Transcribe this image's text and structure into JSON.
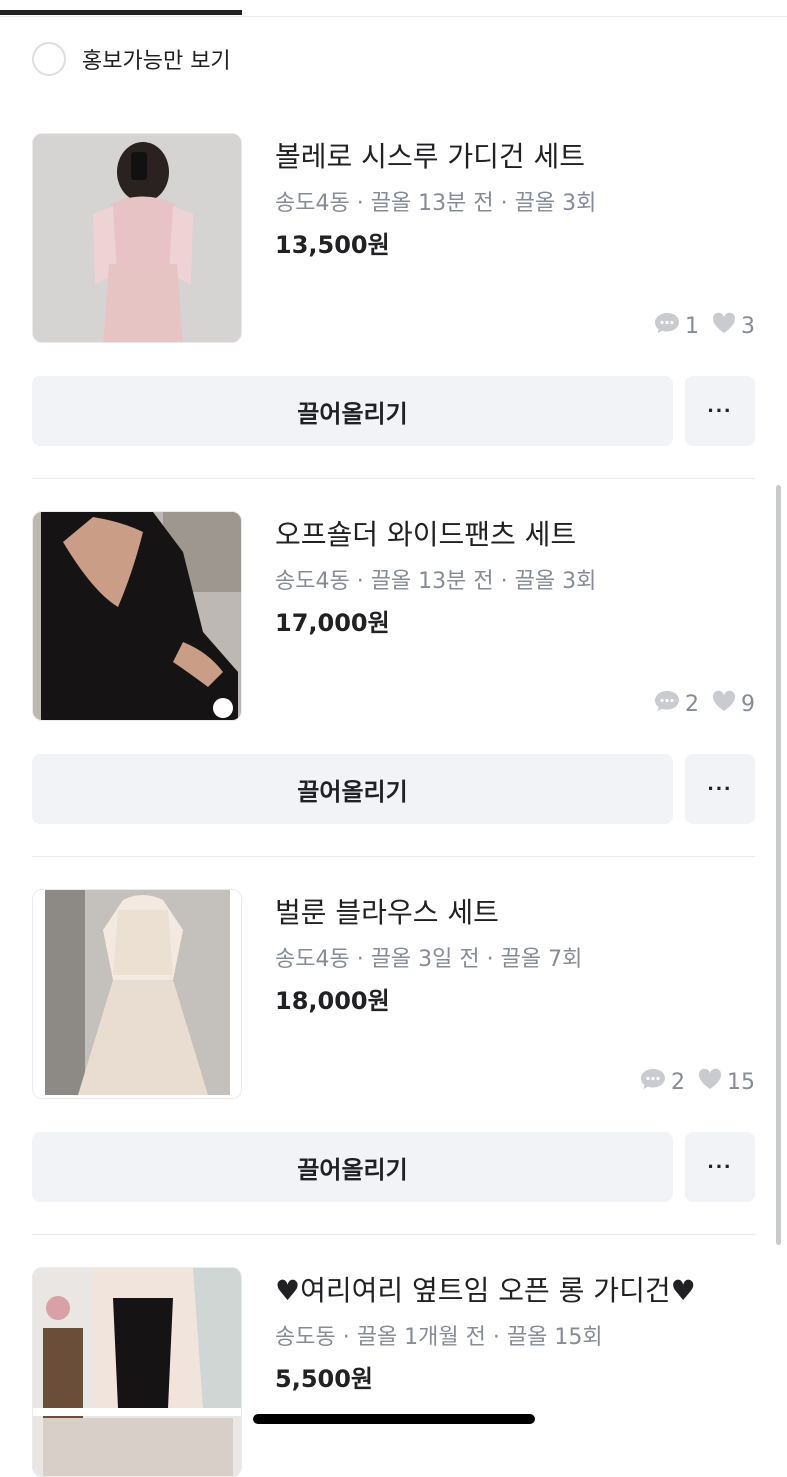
{
  "filter": {
    "label": "홍보가능만 보기"
  },
  "items": [
    {
      "title": "볼레로 시스루 가디건 세트",
      "meta": "송도4동 · 끌올 13분 전 · 끌올 3회",
      "price": "13,500원",
      "comments": "1",
      "likes": "3",
      "bump_label": "끌어올리기",
      "more_label": "···"
    },
    {
      "title": "오프숄더 와이드팬츠 세트",
      "meta": "송도4동 · 끌올 13분 전 · 끌올 3회",
      "price": "17,000원",
      "comments": "2",
      "likes": "9",
      "bump_label": "끌어올리기",
      "more_label": "···"
    },
    {
      "title": "벌룬 블라우스 세트",
      "meta": "송도4동 · 끌올 3일 전 · 끌올 7회",
      "price": "18,000원",
      "comments": "2",
      "likes": "15",
      "bump_label": "끌어올리기",
      "more_label": "···"
    },
    {
      "title": "♥여리여리 옆트임 오픈 롱 가디건♥",
      "meta": "송도동 · 끌올 1개월 전 · 끌올 15회",
      "price": "5,500원"
    }
  ],
  "colors": {
    "text": "#212124",
    "subtext": "#868b94",
    "button_bg": "#f2f3f6",
    "divider": "#eaebee"
  }
}
